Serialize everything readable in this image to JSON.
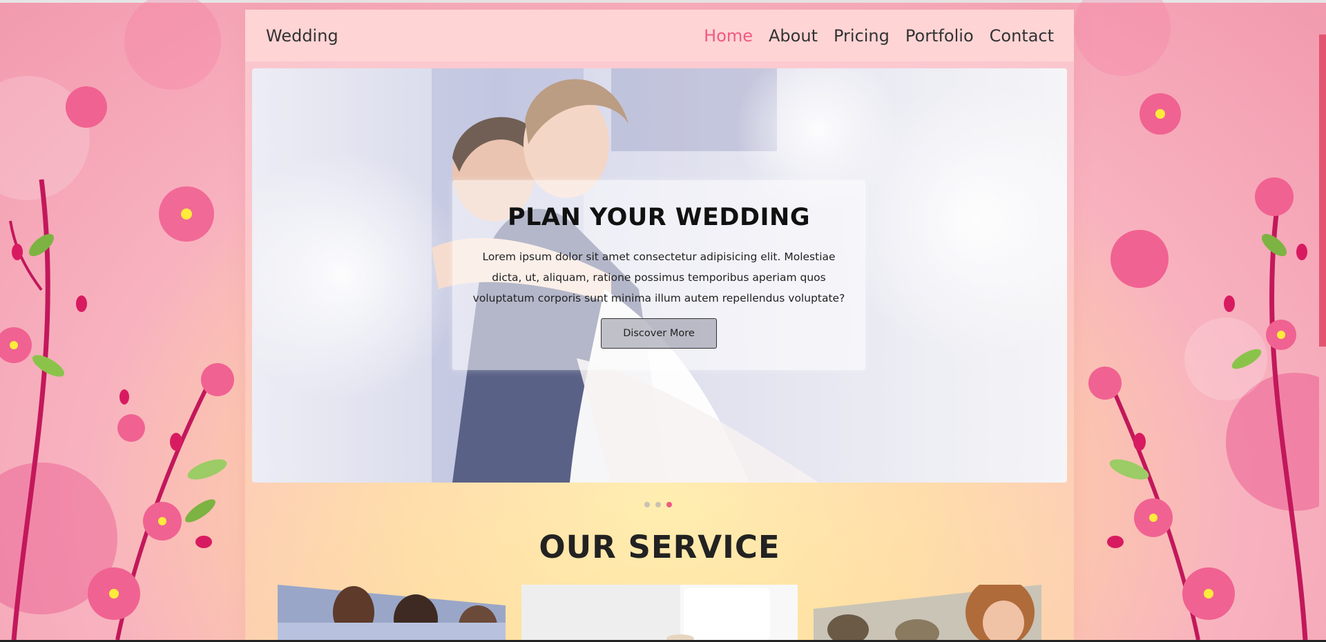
{
  "navbar": {
    "brand": "Wedding",
    "links": [
      {
        "label": "Home",
        "active": true
      },
      {
        "label": "About",
        "active": false
      },
      {
        "label": "Pricing",
        "active": false
      },
      {
        "label": "Portfolio",
        "active": false
      },
      {
        "label": "Contact",
        "active": false
      }
    ]
  },
  "hero": {
    "title": "PLAN YOUR WEDDING",
    "text": "Lorem ipsum dolor sit amet consectetur adipisicing elit. Molestiae dicta, ut, aliquam, ratione possimus temporibus aperiam quos voluptatum corporis sunt minima illum autem repellendus voluptate?",
    "button_label": "Discover More",
    "image": "bride-and-groom-embracing-photo"
  },
  "carousel": {
    "slide_count": 3,
    "active_index": 2
  },
  "services": {
    "title": "OUR SERVICE",
    "cards": [
      {
        "image": "bridesmaids-photo"
      },
      {
        "image": "wedding-cake-photo"
      },
      {
        "image": "smiling-bride-photo"
      }
    ]
  },
  "colors": {
    "accent": "#ef5a82",
    "navbar_bg": "#ffd6d6",
    "text_dark": "#333333"
  }
}
